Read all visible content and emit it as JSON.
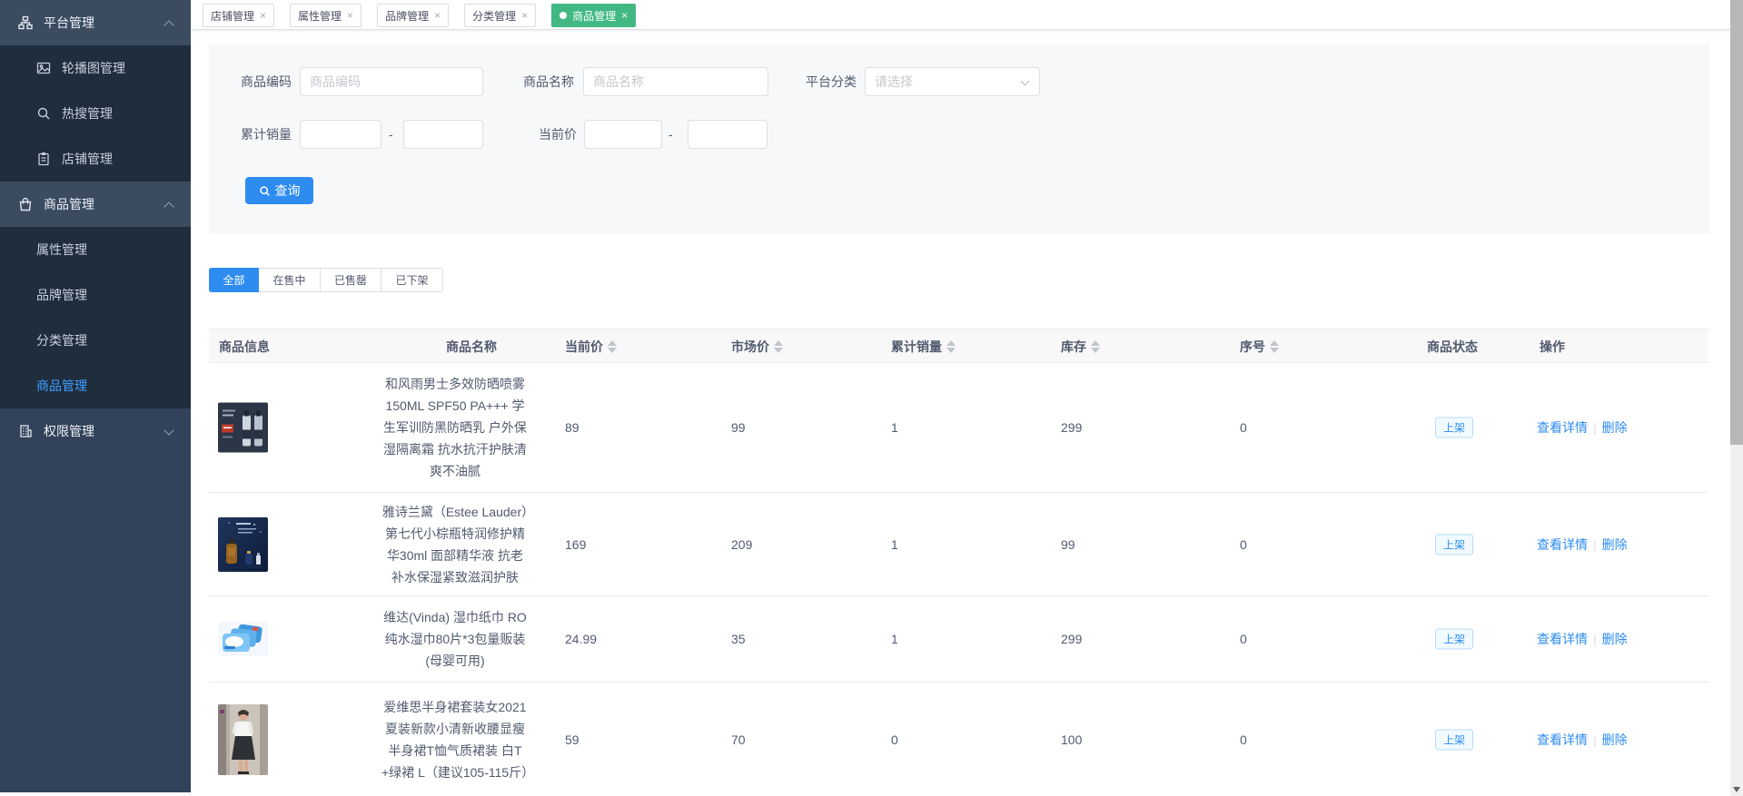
{
  "colors": {
    "accent_blue": "#2d8cf0",
    "tag_active_green": "#42b983",
    "sidebar_active_blue": "#409eff",
    "sidebar_bg": "#32425a",
    "submenu_bg": "#1f2d3d"
  },
  "sidebar": {
    "platform": "平台管理",
    "platform_children": [
      "轮播图管理",
      "热搜管理",
      "店铺管理"
    ],
    "product": "商品管理",
    "product_children": [
      "属性管理",
      "品牌管理",
      "分类管理",
      "商品管理"
    ],
    "active_child": "商品管理",
    "permission": "权限管理",
    "icons": [
      "sitemap-icon",
      "picture-icon",
      "search-icon",
      "clipboard-icon",
      "shopping-bag-icon",
      "office-building-icon"
    ]
  },
  "tags_bar": {
    "close_glyph": "×",
    "tabs": [
      {
        "label": "店铺管理",
        "active": false
      },
      {
        "label": "属性管理",
        "active": false
      },
      {
        "label": "品牌管理",
        "active": false
      },
      {
        "label": "分类管理",
        "active": false
      },
      {
        "label": "商品管理",
        "active": true
      }
    ]
  },
  "form": {
    "product_code": {
      "label": "商品编码",
      "placeholder": "商品编码",
      "value": ""
    },
    "product_name": {
      "label": "商品名称",
      "placeholder": "商品名称",
      "value": ""
    },
    "platform_category": {
      "label": "平台分类",
      "placeholder": "请选择"
    },
    "total_sales_range": {
      "label": "累计销量",
      "min": "",
      "max": ""
    },
    "current_price_range": {
      "label": "当前价",
      "min": "",
      "max": ""
    },
    "range_separator": "-",
    "query_label": "查询"
  },
  "filters": {
    "active": "全部",
    "options": [
      {
        "label": "全部"
      },
      {
        "label": "在售中"
      },
      {
        "label": "已售罄"
      },
      {
        "label": "已下架"
      }
    ]
  },
  "table": {
    "headers": {
      "info": "商品信息",
      "name": "商品名称",
      "current_price": "当前价",
      "market_price": "市场价",
      "total_sales": "累计销量",
      "stock": "库存",
      "seq": "序号",
      "status": "商品状态",
      "actions": "操作"
    },
    "sortable_columns": [
      "当前价",
      "市场价",
      "累计销量",
      "库存",
      "序号"
    ],
    "rows": [
      {
        "name": "和风雨男士多效防晒喷雾 150ML SPF50 PA+++ 学生军训防黑防晒乳 户外保湿隔离霜 抗水抗汗护肤清爽不油腻",
        "current_price": "89",
        "market_price": "99",
        "total_sales": "1",
        "stock": "299",
        "seq": "0",
        "status": "上架",
        "view": "查看详情",
        "delete": "删除"
      },
      {
        "name": "雅诗兰黛（Estee Lauder）第七代小棕瓶特润修护精华30ml 面部精华液 抗老 补水保湿紧致滋润护肤",
        "current_price": "169",
        "market_price": "209",
        "total_sales": "1",
        "stock": "99",
        "seq": "0",
        "status": "上架",
        "view": "查看详情",
        "delete": "删除"
      },
      {
        "name": "维达(Vinda) 湿巾纸巾 RO纯水湿巾80片*3包量贩装 (母婴可用)",
        "current_price": "24.99",
        "market_price": "35",
        "total_sales": "1",
        "stock": "299",
        "seq": "0",
        "status": "上架",
        "view": "查看详情",
        "delete": "删除"
      },
      {
        "name": "爱维思半身裙套装女2021夏装新款小清新收腰显瘦半身裙T恤气质裙装 白T+绿裙 L（建议105-115斤）",
        "current_price": "59",
        "market_price": "70",
        "total_sales": "0",
        "stock": "100",
        "seq": "0",
        "status": "上架",
        "view": "查看详情",
        "delete": "删除"
      }
    ]
  }
}
